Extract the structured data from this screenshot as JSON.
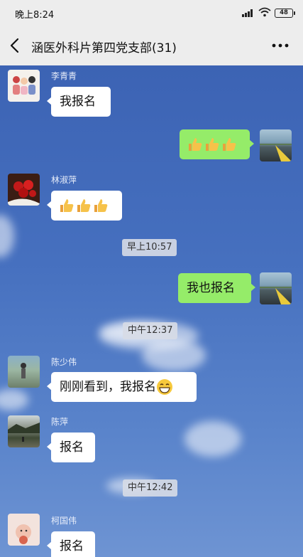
{
  "status_bar": {
    "time": "晚上8:24",
    "battery": "48"
  },
  "header": {
    "title": "涵医外科片第四党支部(31)"
  },
  "messages": [
    {
      "sender": "李青青",
      "text": "我报名"
    },
    {
      "sender": "me",
      "text": ""
    },
    {
      "sender": "林淑萍",
      "text": ""
    },
    {
      "timestamp": "早上10:57"
    },
    {
      "sender": "me",
      "text": "我也报名"
    },
    {
      "timestamp": "中午12:37"
    },
    {
      "sender": "陈少伟",
      "text": "刚刚看到，我报名"
    },
    {
      "sender": "陈萍",
      "text": "报名"
    },
    {
      "timestamp": "中午12:42"
    },
    {
      "sender": "柯国伟",
      "text": "报名"
    }
  ],
  "colors": {
    "incoming_bubble": "#ffffff",
    "outgoing_bubble": "#95ec69",
    "header_bg": "#ededed"
  },
  "icons": {
    "thumbs_up": "thumbs-up-emoji",
    "grin": "grinning-emoji"
  }
}
